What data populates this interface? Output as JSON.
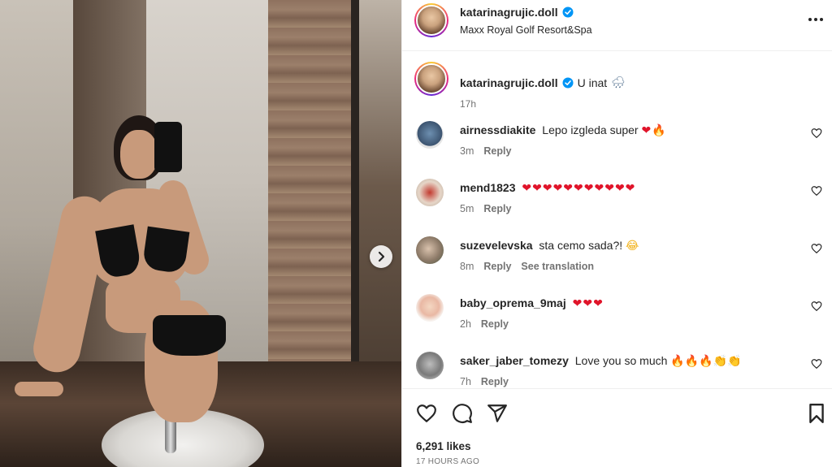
{
  "post": {
    "username": "katarinagrujic.doll",
    "location": "Maxx Royal Golf Resort&Spa",
    "caption_text": "U inat",
    "caption_emoji": "🌧",
    "caption_time": "17h",
    "likes": "6,291 likes",
    "posted_ago": "17 HOURS AGO"
  },
  "comments": [
    {
      "username": "airnessdiakite",
      "text": "Lepo izgleda super",
      "emoji_hearts": "❤",
      "emoji_fire": "🔥",
      "emoji_clap": "",
      "time": "3m",
      "reply": "Reply",
      "translation": ""
    },
    {
      "username": "mend1823",
      "text": "",
      "emoji_hearts": "❤❤❤❤❤❤❤❤❤❤❤",
      "emoji_fire": "",
      "emoji_clap": "",
      "time": "5m",
      "reply": "Reply",
      "translation": ""
    },
    {
      "username": "suzevelevska",
      "text": "sta cemo sada?!",
      "emoji_hearts": "",
      "emoji_fire": "",
      "emoji_clap": "😂",
      "time": "8m",
      "reply": "Reply",
      "translation": "See translation"
    },
    {
      "username": "baby_oprema_9maj",
      "text": "",
      "emoji_hearts": "❤❤❤",
      "emoji_fire": "",
      "emoji_clap": "",
      "time": "2h",
      "reply": "Reply",
      "translation": ""
    },
    {
      "username": "saker_jaber_tomezy",
      "text": "Love you so much",
      "emoji_hearts": "",
      "emoji_fire": "🔥🔥🔥",
      "emoji_clap": "👏👏",
      "time": "7h",
      "reply": "Reply",
      "translation": ""
    }
  ],
  "icons": {
    "verified": "verified-badge-icon",
    "more": "more-options-icon",
    "like": "heart-icon",
    "comment": "comment-icon",
    "share": "share-icon",
    "save": "bookmark-icon",
    "next": "chevron-right-icon"
  },
  "colors": {
    "verified_blue": "#0095f6",
    "text": "#262626",
    "secondary_text": "#737373",
    "heart_red": "#e0142a"
  }
}
